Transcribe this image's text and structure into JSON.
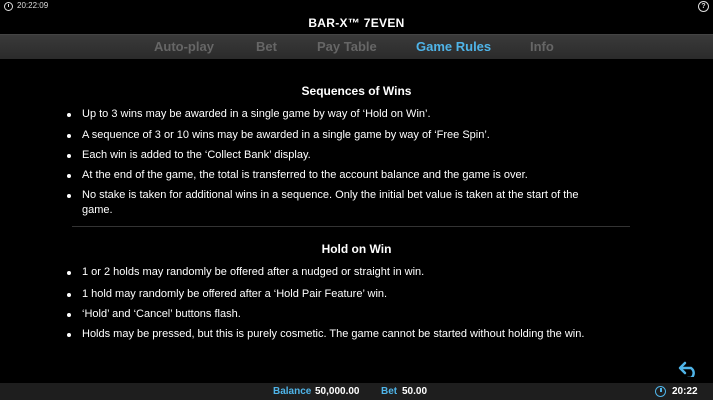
{
  "status_bar": {
    "time": "20:22:09",
    "help_symbol": "?"
  },
  "title": "BAR-X™ 7EVEN",
  "tabs": [
    {
      "label": "Auto-play",
      "active": false
    },
    {
      "label": "Bet",
      "active": false
    },
    {
      "label": "Pay Table",
      "active": false
    },
    {
      "label": "Game Rules",
      "active": true
    },
    {
      "label": "Info",
      "active": false
    }
  ],
  "sections": [
    {
      "title": "Sequences of Wins",
      "bullets": [
        "Up to 3 wins may be awarded in a single game by way of ‘Hold on Win’.",
        "A sequence of 3 or 10 wins may be awarded in a single game by way of ‘Free Spin’.",
        "Each win is added to the ‘Collect Bank’ display.",
        "At the end of the game, the total is transferred to the account balance and the game is over.",
        "No stake is taken for additional wins in a sequence. Only the initial bet value is taken at the start of the game."
      ]
    },
    {
      "title": "Hold on Win",
      "bullets": [
        "1 or 2 holds may randomly be offered after a nudged or straight in win.",
        "1 hold may randomly be offered after a ‘Hold Pair Feature’ win.",
        "‘Hold’ and ‘Cancel’ buttons flash.",
        "Holds may be pressed, but this is purely cosmetic. The game cannot be started without holding the win."
      ]
    }
  ],
  "bottom_bar": {
    "balance_label": "Balance",
    "balance_value": "50,000.00",
    "bet_label": "Bet",
    "bet_value": "50.00",
    "time": "20:22"
  },
  "colors": {
    "accent": "#4fb4e8",
    "inactive_tab": "#666666",
    "tab_bar": "#333333"
  },
  "icons": {
    "status_clock": "clock-icon",
    "help": "help-icon",
    "back": "back-arrow-icon",
    "bottom_clock": "clock-icon"
  }
}
